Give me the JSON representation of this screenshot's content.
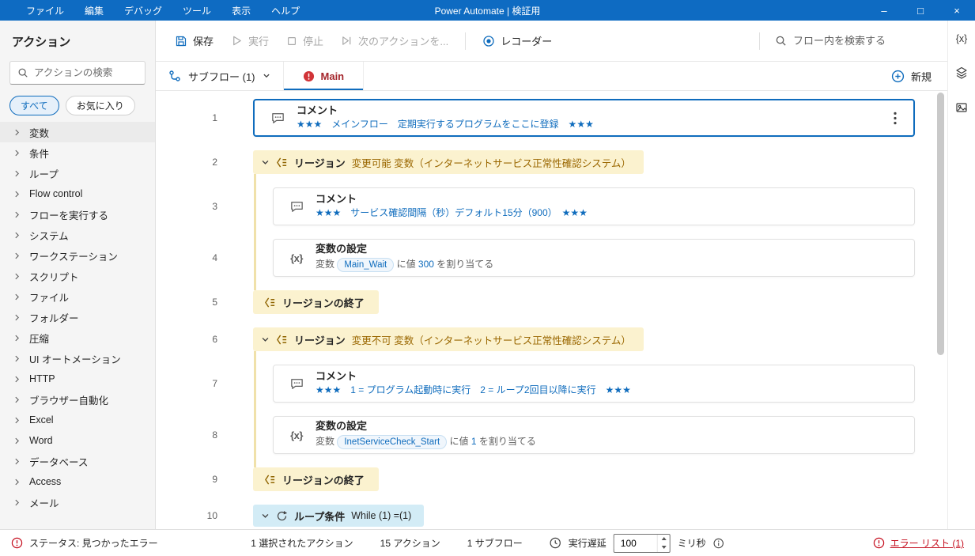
{
  "titlebar": {
    "menus": [
      "ファイル",
      "編集",
      "デバッグ",
      "ツール",
      "表示",
      "ヘルプ"
    ],
    "title": "Power Automate | 検証用",
    "minimize": "–",
    "maximize": "□",
    "close": "×"
  },
  "toolbar": {
    "save": "保存",
    "run": "実行",
    "stop": "停止",
    "step": "次のアクションを...",
    "recorder": "レコーダー",
    "search_placeholder": "フロー内を検索する"
  },
  "tabbar": {
    "subflow": "サブフロー (1)",
    "main": "Main",
    "new": "新規"
  },
  "sidebar": {
    "title": "アクション",
    "search_placeholder": "アクションの検索",
    "filter_all": "すべて",
    "filter_fav": "お気に入り",
    "items": [
      "変数",
      "条件",
      "ループ",
      "Flow control",
      "フローを実行する",
      "システム",
      "ワークステーション",
      "スクリプト",
      "ファイル",
      "フォルダー",
      "圧縮",
      "UI オートメーション",
      "HTTP",
      "ブラウザー自動化",
      "Excel",
      "Word",
      "データベース",
      "Access",
      "メール"
    ]
  },
  "icons": {
    "set_variable_glyph": "{x}"
  },
  "rightrail": {
    "variables": "{x}"
  },
  "flow": {
    "rows": [
      {
        "n": "1",
        "kind": "card",
        "icon": "comment",
        "title": "コメント",
        "selected": true,
        "menu": true,
        "indent": 0,
        "subtitle": [
          {
            "t": "★★★　メインフロー　定期実行するプログラムをここに登録　★★★",
            "c": "blue"
          }
        ]
      },
      {
        "n": "2",
        "kind": "region",
        "label": "リージョン",
        "param": "変更可能 変数（インターネットサービス正常性確認システム）",
        "indent": 0
      },
      {
        "n": "3",
        "kind": "card",
        "icon": "comment",
        "title": "コメント",
        "indent": 1,
        "subtitle": [
          {
            "t": "★★★　サービス確認間隔（秒）デフォルト15分（900）　★★★",
            "c": "blue"
          }
        ]
      },
      {
        "n": "4",
        "kind": "card",
        "icon": "varset",
        "title": "変数の設定",
        "indent": 1,
        "subtitle": [
          {
            "t": "変数 "
          },
          {
            "t": "Main_Wait",
            "c": "pill"
          },
          {
            "t": " に値 "
          },
          {
            "t": "300",
            "c": "blue"
          },
          {
            "t": " を割り当てる"
          }
        ]
      },
      {
        "n": "5",
        "kind": "region-end",
        "label": "リージョンの終了",
        "indent": 0
      },
      {
        "n": "6",
        "kind": "region",
        "label": "リージョン",
        "param": "変更不可 変数（インターネットサービス正常性確認システム）",
        "indent": 0
      },
      {
        "n": "7",
        "kind": "card",
        "icon": "comment",
        "title": "コメント",
        "indent": 1,
        "subtitle": [
          {
            "t": "★★★　1 = プログラム起動時に実行　2 = ループ2回目以降に実行　★★★",
            "c": "blue"
          }
        ]
      },
      {
        "n": "8",
        "kind": "card",
        "icon": "varset",
        "title": "変数の設定",
        "indent": 1,
        "subtitle": [
          {
            "t": "変数 "
          },
          {
            "t": "InetServiceCheck_Start",
            "c": "pill"
          },
          {
            "t": " に値 "
          },
          {
            "t": "1",
            "c": "blue"
          },
          {
            "t": " を割り当てる"
          }
        ]
      },
      {
        "n": "9",
        "kind": "region-end",
        "label": "リージョンの終了",
        "indent": 0
      },
      {
        "n": "10",
        "kind": "loop",
        "label": "ループ条件",
        "param": "While (1) =(1)",
        "indent": 0
      }
    ]
  },
  "statusbar": {
    "status": "ステータス: 見つかったエラー",
    "selected_actions": "1 選択されたアクション",
    "actions_count": "15 アクション",
    "subflow_count": "1 サブフロー",
    "delay_label": "実行遅延",
    "delay_value": "100",
    "delay_unit": "ミリ秒",
    "error_list": "エラー リスト (1)"
  },
  "colors": {
    "accent": "#0f6cbd",
    "titlebar": "#0e6bc2",
    "error": "#c50f1f",
    "region_bg": "#fbf2cf",
    "loop_bg": "#d3ecf6"
  }
}
